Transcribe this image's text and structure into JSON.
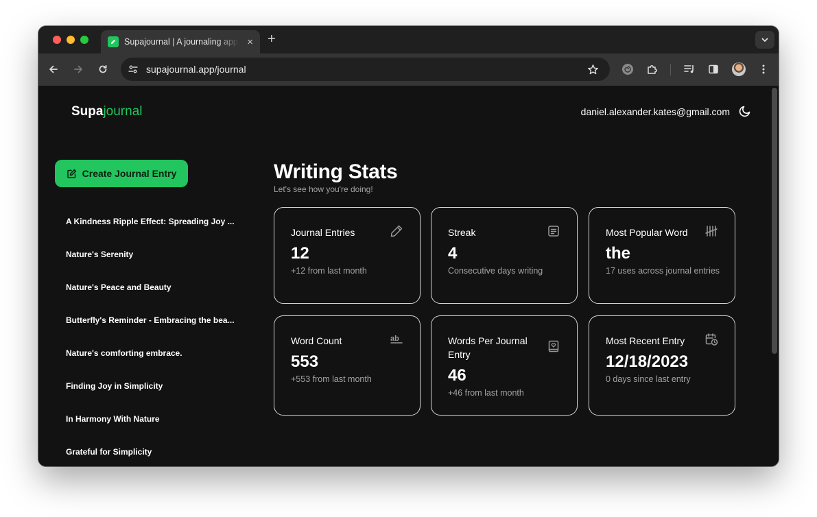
{
  "browser": {
    "tab_title": "Supajournal | A journaling app",
    "tab_close": "×",
    "new_tab": "+",
    "url_host": "supajournal.app",
    "url_path": "/journal"
  },
  "header": {
    "brand_prefix": "Supa",
    "brand_suffix": "journal",
    "user_email": "daniel.alexander.kates@gmail.com"
  },
  "sidebar": {
    "create_label": "Create Journal Entry",
    "entries": [
      "A Kindness Ripple Effect: Spreading Joy ...",
      "Nature's Serenity",
      "Nature's Peace and Beauty",
      "Butterfly's Reminder - Embracing the bea...",
      "Nature's comforting embrace.",
      "Finding Joy in Simplicity",
      "In Harmony With Nature",
      "Grateful for Simplicity"
    ]
  },
  "stats": {
    "title": "Writing Stats",
    "subtitle": "Let's see how you're doing!",
    "cards": [
      {
        "title": "Journal Entries",
        "value": "12",
        "note": "+12 from last month",
        "icon": "pencil-icon"
      },
      {
        "title": "Streak",
        "value": "4",
        "note": "Consecutive days writing",
        "icon": "notepad-icon"
      },
      {
        "title": "Most Popular Word",
        "value": "the",
        "note": "17 uses across journal entries",
        "icon": "tally-icon"
      },
      {
        "title": "Word Count",
        "value": "553",
        "note": "+553 from last month",
        "icon": "text-ab-icon"
      },
      {
        "title": "Words Per Journal Entry",
        "value": "46",
        "note": "+46 from last month",
        "icon": "book-heart-icon"
      },
      {
        "title": "Most Recent Entry",
        "value": "12/18/2023",
        "note": "0 days since last entry",
        "icon": "calendar-clock-icon"
      }
    ]
  },
  "colors": {
    "accent": "#22c55e",
    "background": "#121212",
    "card_border": "#d6d6d6",
    "muted_text": "#a3a3a3"
  }
}
